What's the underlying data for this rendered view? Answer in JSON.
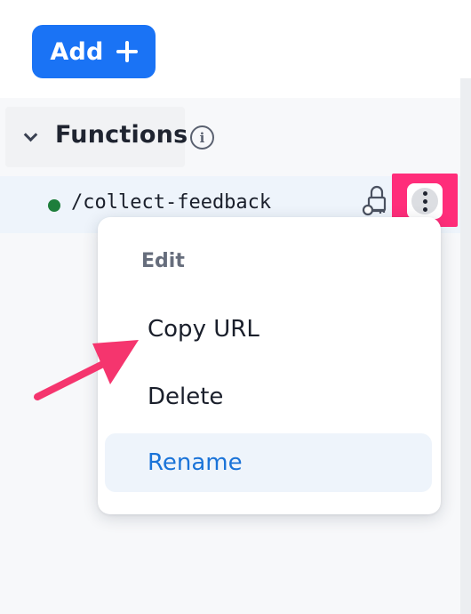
{
  "toolbar": {
    "add_label": "Add"
  },
  "section": {
    "title": "Functions"
  },
  "function_row": {
    "path": "/collect-feedback",
    "status_color": "#1e7e3b"
  },
  "menu": {
    "items": [
      {
        "label": "Edit"
      },
      {
        "label": "Copy URL"
      },
      {
        "label": "Delete"
      },
      {
        "label": "Rename"
      }
    ]
  },
  "colors": {
    "accent": "#1a73f5",
    "highlight": "#ff2d7a",
    "link": "#1a73d8"
  },
  "icons": {
    "add": "plus-icon",
    "collapse": "chevron-down-icon",
    "info": "info-icon",
    "visibility": "lock-key-icon",
    "more": "kebab-menu-icon"
  }
}
